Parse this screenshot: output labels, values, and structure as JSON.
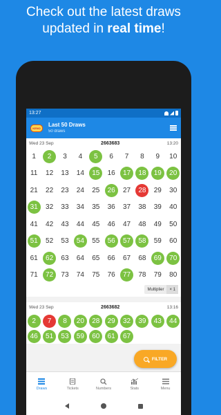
{
  "promo": {
    "line1": "Check out the latest draws",
    "line2_prefix": "updated in ",
    "line2_bold": "real time",
    "line2_suffix": "!"
  },
  "status": {
    "time": "13:27"
  },
  "appbar": {
    "logo_text": "KENO",
    "title": "Last 50 Draws",
    "subtitle": "50 draws"
  },
  "draws": [
    {
      "date": "Wed 23 Sep",
      "id": "2663683",
      "time": "13:20",
      "numbers": [
        1,
        2,
        3,
        4,
        5,
        6,
        7,
        8,
        9,
        10,
        11,
        12,
        13,
        14,
        15,
        16,
        17,
        18,
        19,
        20,
        21,
        22,
        23,
        24,
        25,
        26,
        27,
        28,
        29,
        30,
        31,
        32,
        33,
        34,
        35,
        36,
        37,
        38,
        39,
        40,
        41,
        42,
        43,
        44,
        45,
        46,
        47,
        48,
        49,
        50,
        51,
        52,
        53,
        54,
        55,
        56,
        57,
        58,
        59,
        60,
        61,
        62,
        63,
        64,
        65,
        66,
        67,
        68,
        69,
        70,
        71,
        72,
        73,
        74,
        75,
        76,
        77,
        78,
        79,
        80
      ],
      "hits": [
        2,
        5,
        15,
        17,
        18,
        19,
        20,
        26,
        31,
        51,
        54,
        56,
        57,
        58,
        62,
        69,
        70,
        72,
        77
      ],
      "bonus": [
        28
      ],
      "multiplier_label": "Multiplier",
      "multiplier_value": "× 1"
    },
    {
      "date": "Wed 23 Sep",
      "id": "2663682",
      "time": "13:16",
      "drawn": [
        2,
        7,
        8,
        20,
        28,
        29,
        32,
        39,
        43,
        44,
        46,
        51,
        53,
        59,
        60,
        61,
        67
      ],
      "bonus": [
        7
      ]
    }
  ],
  "filter": {
    "label": "FILTER"
  },
  "nav": [
    {
      "label": "Draws",
      "icon": "list-icon",
      "active": true
    },
    {
      "label": "Tickets",
      "icon": "ticket-icon",
      "active": false
    },
    {
      "label": "Numbers",
      "icon": "search-icon",
      "active": false
    },
    {
      "label": "Stats",
      "icon": "chart-icon",
      "active": false
    },
    {
      "label": "Menu",
      "icon": "menu-icon",
      "active": false
    }
  ],
  "colors": {
    "brand": "#1e88e5",
    "hit": "#7cc242",
    "bonus": "#e53935",
    "filter": "#f9a825"
  }
}
